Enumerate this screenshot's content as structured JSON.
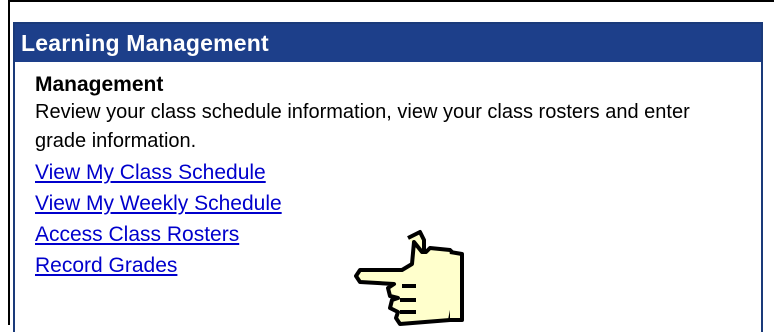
{
  "panel": {
    "title": "Learning Management",
    "section_title": "Management",
    "description": "Review your class schedule information, view your class rosters and enter grade information.",
    "links": [
      "View My Class Schedule",
      "View My Weekly Schedule",
      "Access Class Rosters",
      "Record Grades"
    ]
  },
  "colors": {
    "header_bg": "#1d3f8a",
    "header_text": "#ffffff",
    "link": "#0000cc",
    "hand_fill": "#ffffcc"
  },
  "icons": {
    "pointer": "pointing-hand-icon"
  }
}
